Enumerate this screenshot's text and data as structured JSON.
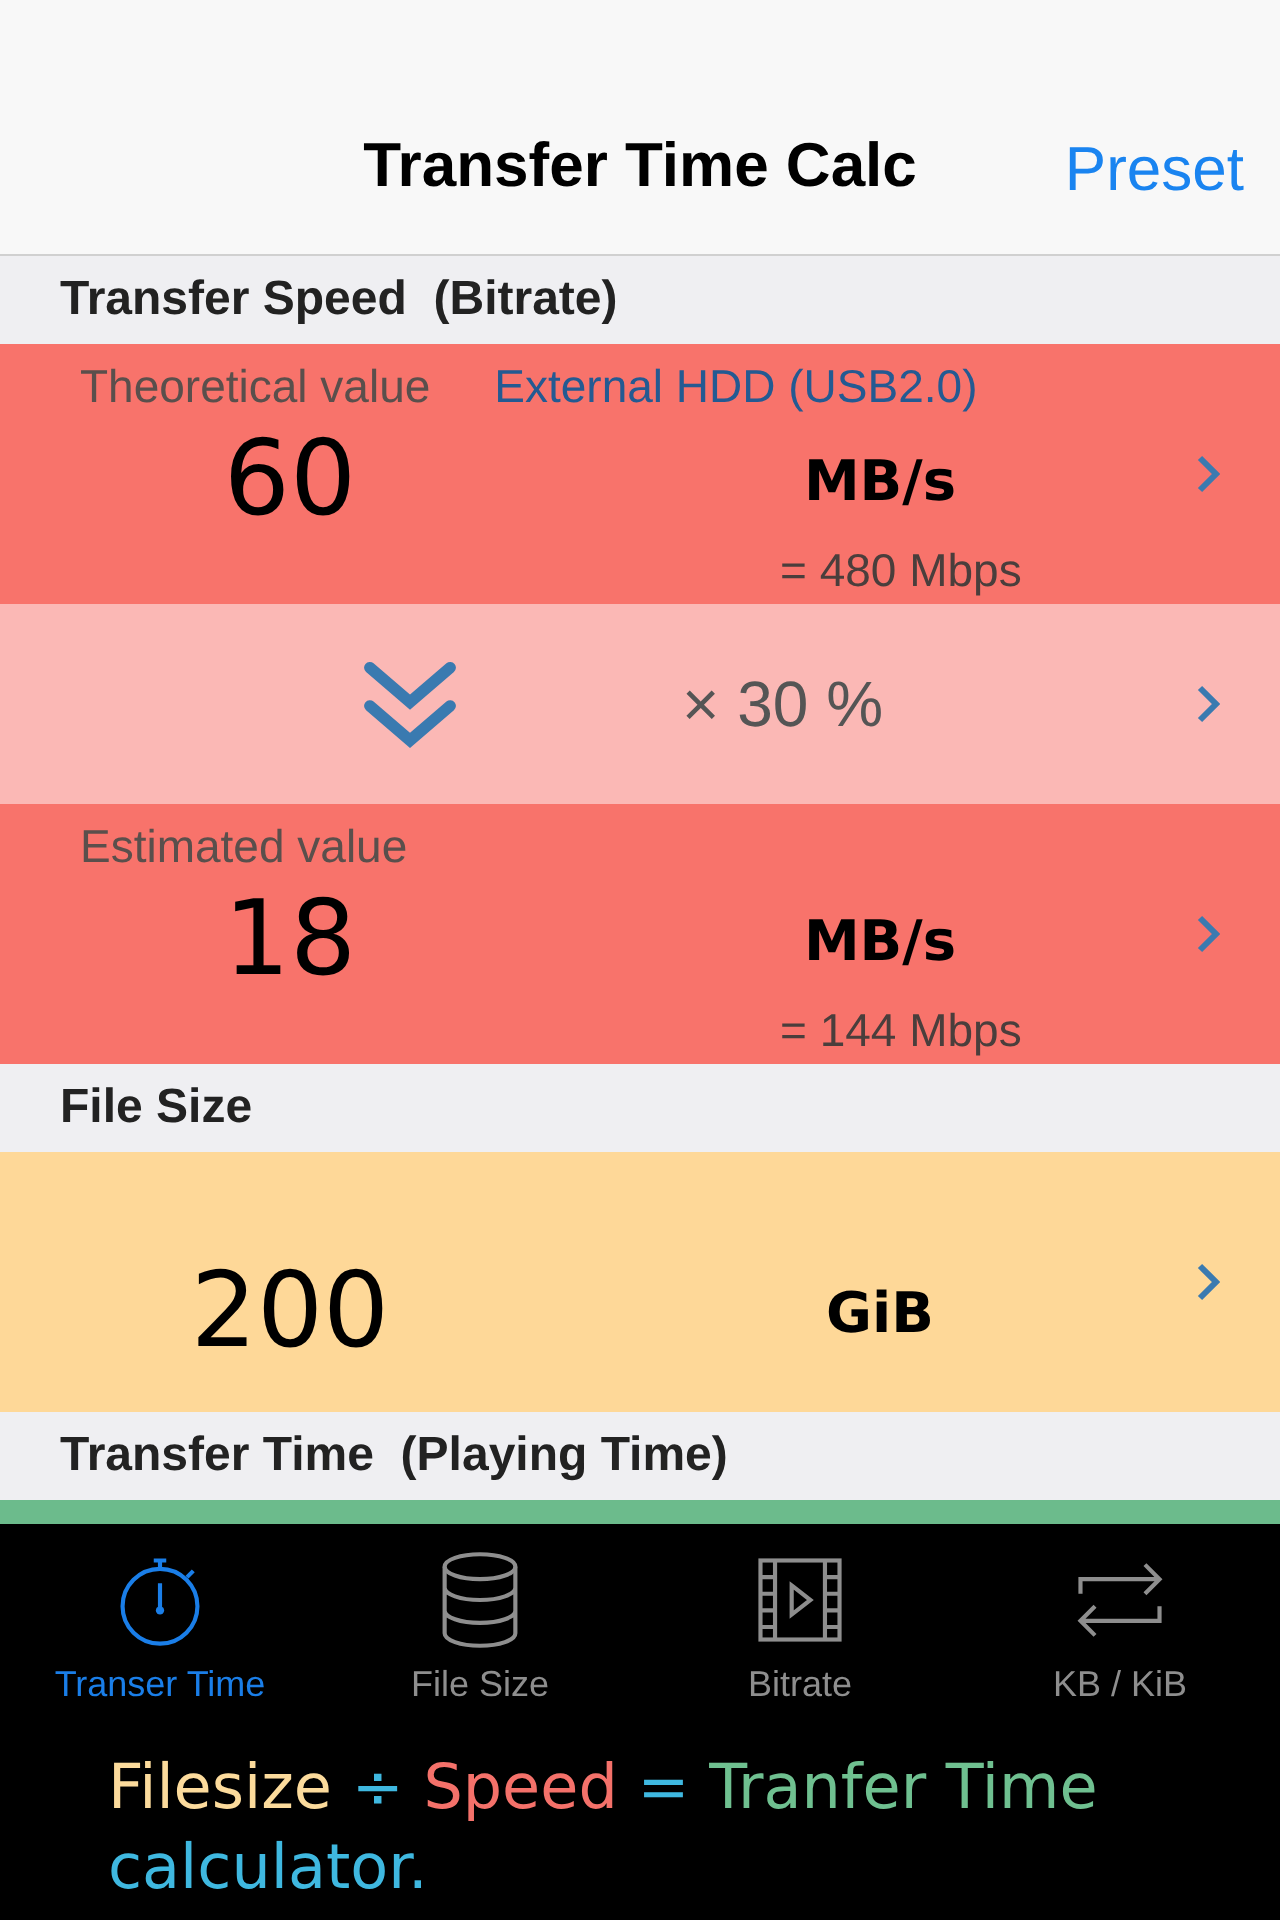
{
  "nav": {
    "title": "Transfer Time Calc",
    "action": "Preset"
  },
  "sections": [
    {
      "header": "Transfer Speed  (Bitrate)",
      "rows": [
        {
          "kind": "value",
          "label": "Theoretical value",
          "preset": "External HDD (USB2.0)",
          "value": "60",
          "unit": "MB/s",
          "sub": "= 480 Mbps",
          "color": "#f8736b"
        },
        {
          "kind": "factor",
          "value": "× 30 %",
          "color": "#fbb8b5"
        },
        {
          "kind": "value",
          "label": "Estimated value",
          "value": "18",
          "unit": "MB/s",
          "sub": "= 144 Mbps",
          "color": "#f8736b"
        }
      ]
    },
    {
      "header": "File Size",
      "rows": [
        {
          "kind": "value",
          "value": "200",
          "unit": "GiB",
          "color": "#fed898"
        }
      ]
    },
    {
      "header": "Transfer Time  (Playing Time)",
      "rows": [
        {
          "kind": "strip",
          "color": "#6cbb8c"
        }
      ]
    }
  ],
  "tabs": [
    {
      "label": "Transer Time",
      "kind": "stopwatch",
      "selected": true
    },
    {
      "label": "File Size",
      "kind": "database",
      "selected": false
    },
    {
      "label": "Bitrate",
      "kind": "film",
      "selected": false
    },
    {
      "label": "KB / KiB",
      "kind": "repeat",
      "selected": false
    }
  ],
  "caption": [
    {
      "text": "Filesize",
      "color": "#fcdb9c"
    },
    {
      "text": "÷",
      "color": "#3fb8e0"
    },
    {
      "text": "Speed",
      "color": "#f4716a"
    },
    {
      "text": "=",
      "color": "#3fb8e0"
    },
    {
      "text": "Tranfer Time",
      "color": "#6fc090"
    },
    {
      "text": "calculator.",
      "color": "#3fb8e0"
    }
  ]
}
